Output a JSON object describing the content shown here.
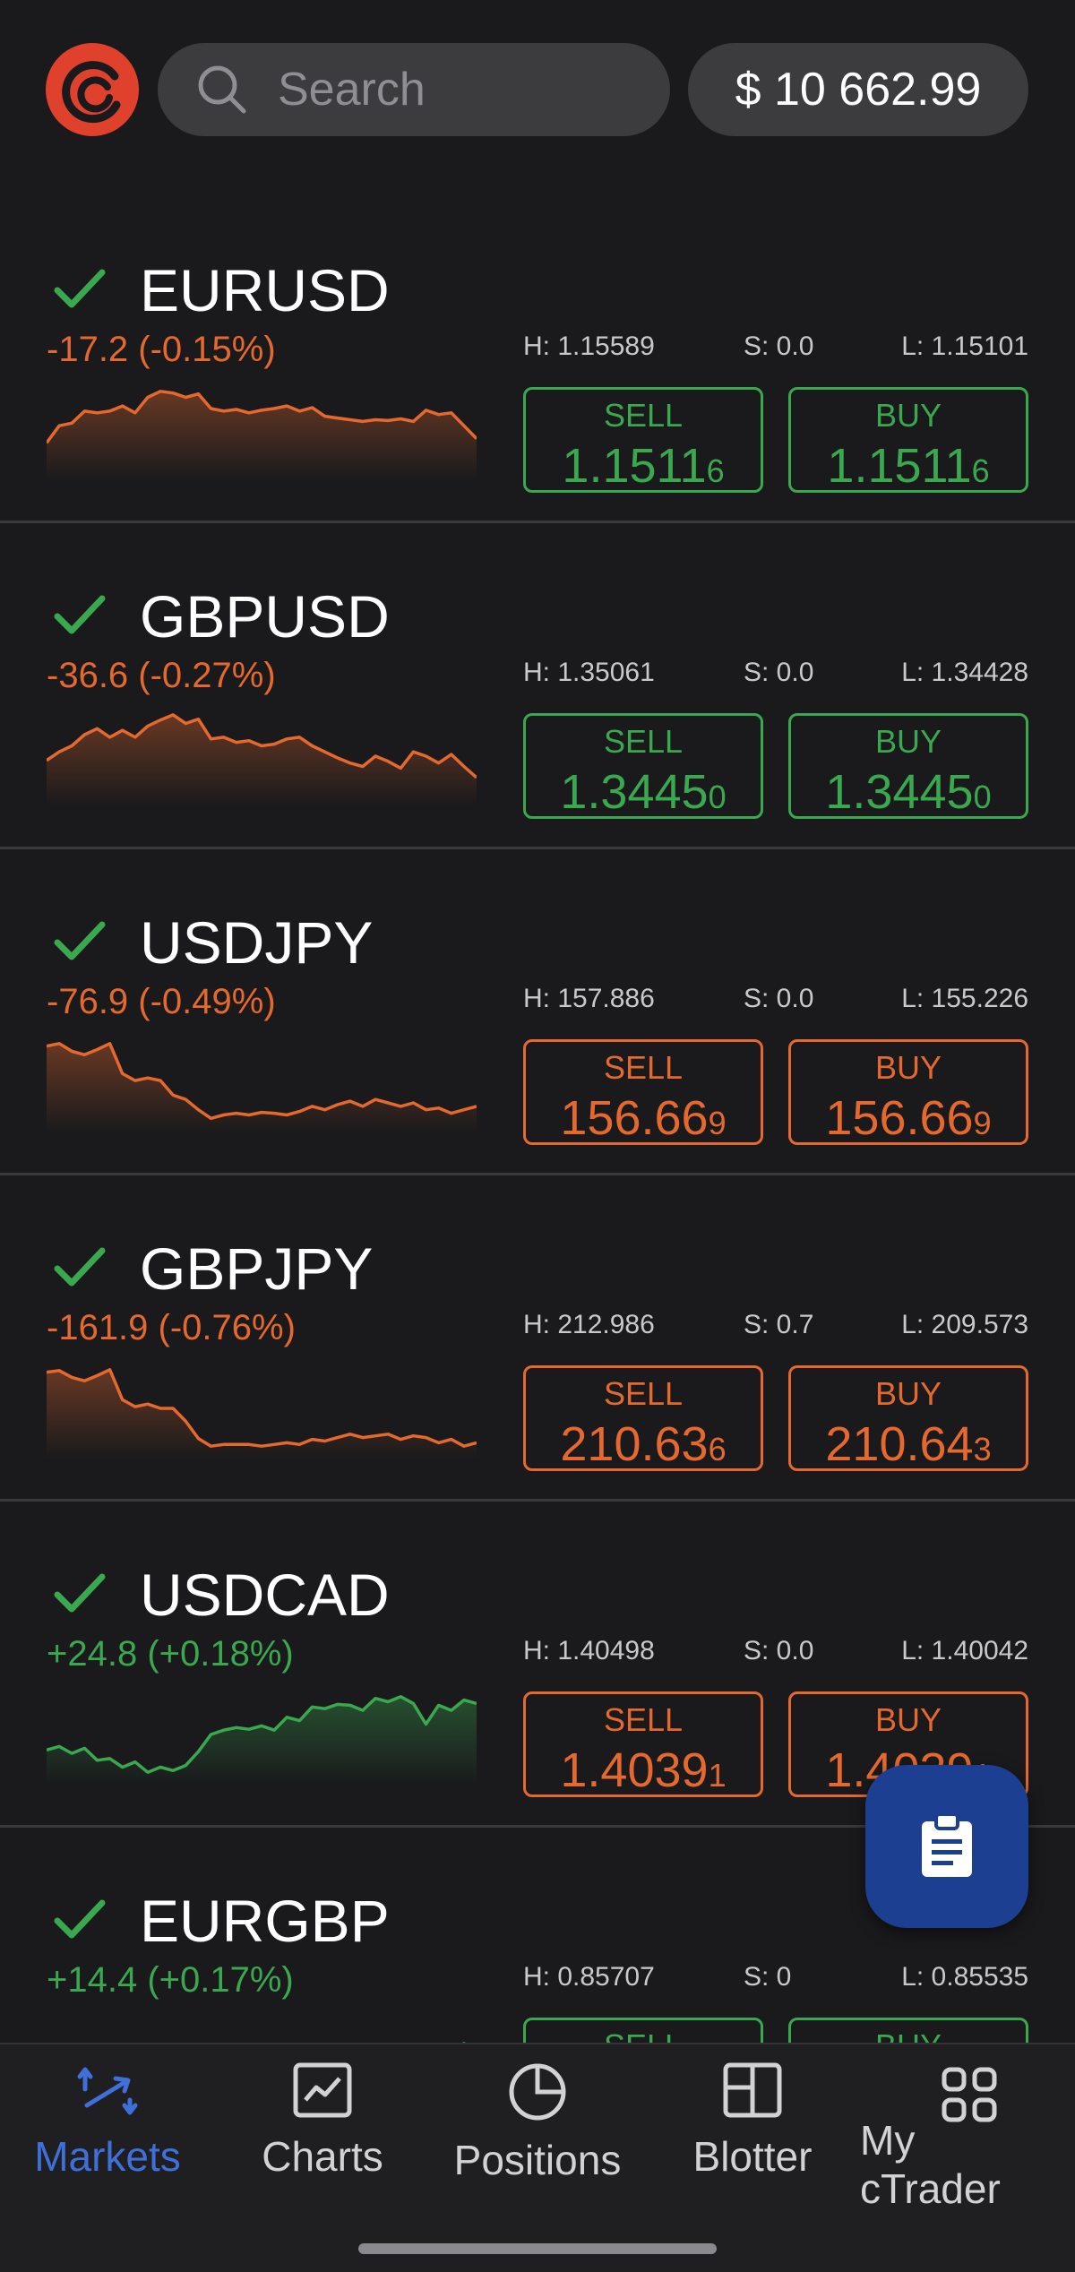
{
  "header": {
    "search_placeholder": "Search",
    "balance": "$ 10 662.99"
  },
  "colors": {
    "up": "#3aa84f",
    "down": "#e5692f",
    "accent": "#3f6fd8",
    "fab": "#1c3f91"
  },
  "instruments": [
    {
      "symbol": "EURUSD",
      "change": "-17.2 (-0.15%)",
      "direction": "down",
      "high": "H: 1.15589",
      "spread": "S: 0.0",
      "low": "L: 1.15101",
      "sell_label": "SELL",
      "sell_main": "1.1511",
      "sell_pip": "6",
      "buy_label": "BUY",
      "buy_main": "1.1511",
      "buy_pip": "6",
      "button_color": "up",
      "trend": [
        0.35,
        0.55,
        0.58,
        0.72,
        0.7,
        0.72,
        0.78,
        0.7,
        0.88,
        0.95,
        0.93,
        0.88,
        0.92,
        0.75,
        0.72,
        0.74,
        0.7,
        0.73,
        0.75,
        0.78,
        0.72,
        0.76,
        0.66,
        0.64,
        0.62,
        0.6,
        0.62,
        0.61,
        0.63,
        0.6,
        0.73,
        0.68,
        0.7,
        0.55,
        0.4
      ]
    },
    {
      "symbol": "GBPUSD",
      "change": "-36.6 (-0.27%)",
      "direction": "down",
      "high": "H: 1.35061",
      "spread": "S: 0.0",
      "low": "L: 1.34428",
      "sell_label": "SELL",
      "sell_main": "1.3445",
      "sell_pip": "0",
      "buy_label": "BUY",
      "buy_main": "1.3445",
      "buy_pip": "0",
      "button_color": "up",
      "trend": [
        0.45,
        0.55,
        0.62,
        0.75,
        0.82,
        0.72,
        0.8,
        0.72,
        0.85,
        0.92,
        0.98,
        0.88,
        0.93,
        0.7,
        0.72,
        0.66,
        0.68,
        0.62,
        0.64,
        0.7,
        0.72,
        0.62,
        0.55,
        0.48,
        0.42,
        0.38,
        0.5,
        0.44,
        0.36,
        0.55,
        0.5,
        0.42,
        0.52,
        0.38,
        0.25
      ]
    },
    {
      "symbol": "USDJPY",
      "change": "-76.9 (-0.49%)",
      "direction": "down",
      "high": "H: 157.886",
      "spread": "S: 0.0",
      "low": "L: 155.226",
      "sell_label": "SELL",
      "sell_main": "156.66",
      "sell_pip": "9",
      "buy_label": "BUY",
      "buy_main": "156.66",
      "buy_pip": "9",
      "button_color": "down",
      "trend": [
        0.92,
        0.95,
        0.86,
        0.82,
        0.88,
        0.95,
        0.6,
        0.52,
        0.55,
        0.52,
        0.35,
        0.3,
        0.18,
        0.08,
        0.12,
        0.14,
        0.12,
        0.15,
        0.14,
        0.12,
        0.16,
        0.22,
        0.18,
        0.24,
        0.28,
        0.22,
        0.3,
        0.26,
        0.22,
        0.26,
        0.18,
        0.2,
        0.14,
        0.18,
        0.22
      ]
    },
    {
      "symbol": "GBPJPY",
      "change": "-161.9 (-0.76%)",
      "direction": "down",
      "high": "H: 212.986",
      "spread": "S: 0.7",
      "low": "L: 209.573",
      "sell_label": "SELL",
      "sell_main": "210.63",
      "sell_pip": "6",
      "buy_label": "BUY",
      "buy_main": "210.64",
      "buy_pip": "3",
      "button_color": "down",
      "trend": [
        0.92,
        0.94,
        0.86,
        0.82,
        0.88,
        0.95,
        0.6,
        0.52,
        0.55,
        0.5,
        0.5,
        0.35,
        0.15,
        0.06,
        0.08,
        0.08,
        0.08,
        0.06,
        0.08,
        0.1,
        0.08,
        0.14,
        0.12,
        0.16,
        0.2,
        0.16,
        0.18,
        0.2,
        0.14,
        0.18,
        0.16,
        0.1,
        0.14,
        0.06,
        0.1
      ]
    },
    {
      "symbol": "USDCAD",
      "change": "+24.8 (+0.18%)",
      "direction": "up",
      "high": "H: 1.40498",
      "spread": "S: 0.0",
      "low": "L: 1.40042",
      "sell_label": "SELL",
      "sell_main": "1.4039",
      "sell_pip": "1",
      "buy_label": "BUY",
      "buy_main": "1.4039",
      "buy_pip": "1",
      "button_color": "down",
      "trend": [
        0.32,
        0.36,
        0.28,
        0.34,
        0.2,
        0.22,
        0.12,
        0.18,
        0.06,
        0.12,
        0.08,
        0.14,
        0.3,
        0.5,
        0.55,
        0.58,
        0.56,
        0.6,
        0.55,
        0.7,
        0.66,
        0.82,
        0.8,
        0.85,
        0.84,
        0.78,
        0.92,
        0.88,
        0.94,
        0.86,
        0.62,
        0.84,
        0.78,
        0.9,
        0.86
      ]
    },
    {
      "symbol": "EURGBP",
      "change": "+14.4 (+0.17%)",
      "direction": "up",
      "high": "H: 0.85707",
      "spread": "S: 0",
      "low": "L: 0.85535",
      "sell_label": "SELL",
      "sell_main": "",
      "sell_pip": "",
      "buy_label": "BUY",
      "buy_main": "",
      "buy_pip": "",
      "button_color": "up",
      "trend": [
        0.05,
        0.05,
        0.05,
        0.05,
        0.05,
        0.05,
        0.05,
        0.05,
        0.05,
        0.05,
        0.05,
        0.05,
        0.05,
        0.05,
        0.05,
        0.05,
        0.05,
        0.05,
        0.15,
        0.22,
        0.3,
        0.28,
        0.4,
        0.48,
        0.55,
        0.6,
        0.62,
        0.5,
        0.66,
        0.55,
        0.4,
        0.62,
        0.58,
        0.7,
        0.6
      ]
    }
  ],
  "tabs": [
    {
      "label": "Markets",
      "icon": "markets-arrows-icon",
      "active": true
    },
    {
      "label": "Charts",
      "icon": "chart-icon",
      "active": false
    },
    {
      "label": "Positions",
      "icon": "pie-chart-icon",
      "active": false
    },
    {
      "label": "Blotter",
      "icon": "blotter-icon",
      "active": false
    },
    {
      "label_line1": "My",
      "label_line2": "cTrader",
      "icon": "grid-apps-icon",
      "active": false
    }
  ]
}
